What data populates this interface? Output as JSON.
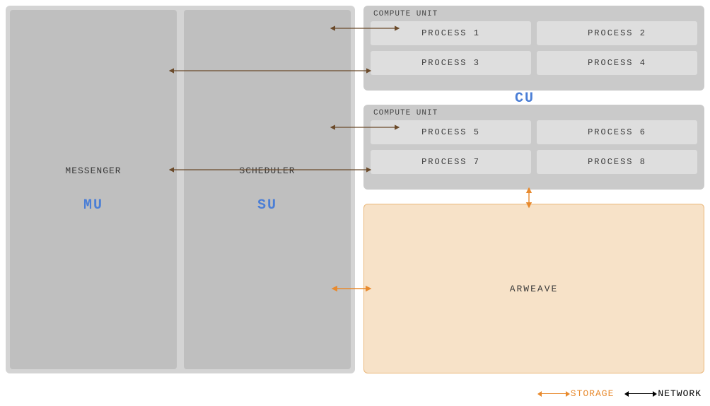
{
  "left": {
    "messenger": {
      "title": "MESSENGER",
      "tag": "MU"
    },
    "scheduler": {
      "title": "SCHEDULER",
      "tag": "SU"
    }
  },
  "compute_units": {
    "header": "COMPUTE UNIT",
    "label": "CU",
    "cu1": {
      "p1": "PROCESS 1",
      "p2": "PROCESS 2",
      "p3": "PROCESS 3",
      "p4": "PROCESS 4"
    },
    "cu2": {
      "p5": "PROCESS 5",
      "p6": "PROCESS 6",
      "p7": "PROCESS 7",
      "p8": "PROCESS 8"
    }
  },
  "arweave": {
    "label": "ARWEAVE"
  },
  "legend": {
    "storage": "STORAGE",
    "network": "NETWORK"
  },
  "colors": {
    "network": "#6b4a2a",
    "storage": "#e88a2e",
    "blue": "#4a7ed6"
  }
}
